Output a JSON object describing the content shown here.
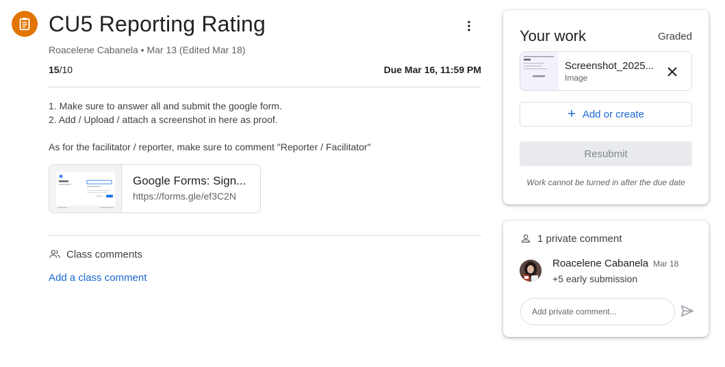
{
  "assignment": {
    "icon": "assignment-icon",
    "icon_color": "#e37400",
    "title": "CU5 Reporting Rating",
    "author": "Roacelene Cabanela",
    "separator": " • ",
    "posted": "Mar 13 (Edited Mar 18)",
    "score": "15",
    "max_points": "/10",
    "due": "Due Mar 16, 11:59 PM",
    "more_icon": "more-vert-icon"
  },
  "instructions": [
    "1. Make sure to answer all and submit the google form.",
    "2. Add / Upload / attach a screenshot in here as proof.",
    "",
    "As for the facilitator / reporter, make sure to comment \"Reporter / Facilitator\""
  ],
  "attachment": {
    "title": "Google Forms: Sign...",
    "url": "https://forms.gle/ef3C2N"
  },
  "class_comments": {
    "icon": "people-icon",
    "label": "Class comments",
    "add_link": "Add a class comment"
  },
  "your_work": {
    "title": "Your work",
    "status": "Graded",
    "file": {
      "name": "Screenshot_2025...",
      "type": "Image",
      "remove_icon": "close-icon"
    },
    "add_button": "Add or create",
    "add_icon": "plus-icon",
    "resubmit_button": "Resubmit",
    "note": "Work cannot be turned in after the due date",
    "accent_color": "#1967d2"
  },
  "private_comments": {
    "icon": "person-icon",
    "label": "1 private comment",
    "comments": [
      {
        "author": "Roacelene Cabanela",
        "date": "Mar 18",
        "text": "+5 early submission"
      }
    ],
    "input_placeholder": "Add private comment...",
    "send_icon": "send-icon"
  }
}
